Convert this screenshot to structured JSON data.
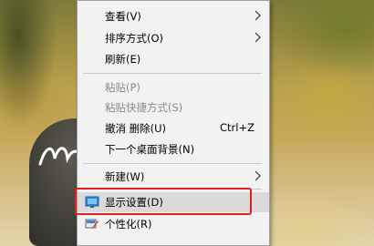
{
  "context_menu": {
    "items": [
      {
        "label": "查看(V)",
        "submenu": true
      },
      {
        "label": "排序方式(O)",
        "submenu": true
      },
      {
        "label": "刷新(E)"
      },
      {
        "label": "粘贴(P)",
        "disabled": true
      },
      {
        "label": "粘贴快捷方式(S)",
        "disabled": true
      },
      {
        "label": "撤消 删除(U)",
        "shortcut": "Ctrl+Z"
      },
      {
        "label": "下一个桌面背景(N)"
      },
      {
        "label": "新建(W)",
        "submenu": true
      },
      {
        "label": "显示设置(D)",
        "icon": "display-icon",
        "hovered": true
      },
      {
        "label": "个性化(R)",
        "icon": "personalize-icon"
      }
    ]
  },
  "colors": {
    "highlight": "#e02020",
    "menu_bg": "#f2f2f2",
    "hover_bg": "#dadada"
  }
}
